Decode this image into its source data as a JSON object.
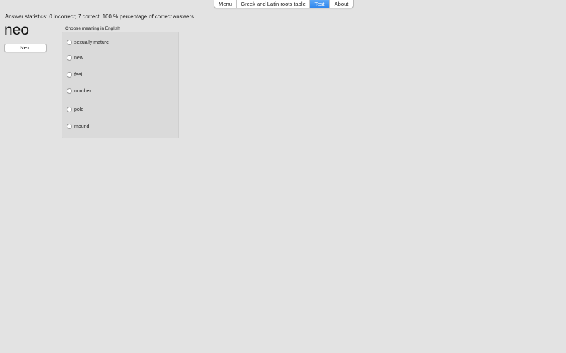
{
  "tabs": {
    "menu": "Menu",
    "table": "Greek and Latin roots table",
    "test": "Test",
    "about": "About",
    "active": "Test"
  },
  "stats": {
    "text": "Answer statistics: 0 incorrect; 7 correct; 100 % percentage of correct answers."
  },
  "question": {
    "word": "neo",
    "next_label": "Next",
    "group_title": "Choose meaning in English",
    "options": [
      "sexually mature",
      "new",
      "feel",
      "number",
      "pole",
      "mound"
    ],
    "selected": null
  },
  "colors": {
    "background": "#e3e3e3",
    "active_tab": "#3b8ff1",
    "group_box": "#dadada"
  }
}
